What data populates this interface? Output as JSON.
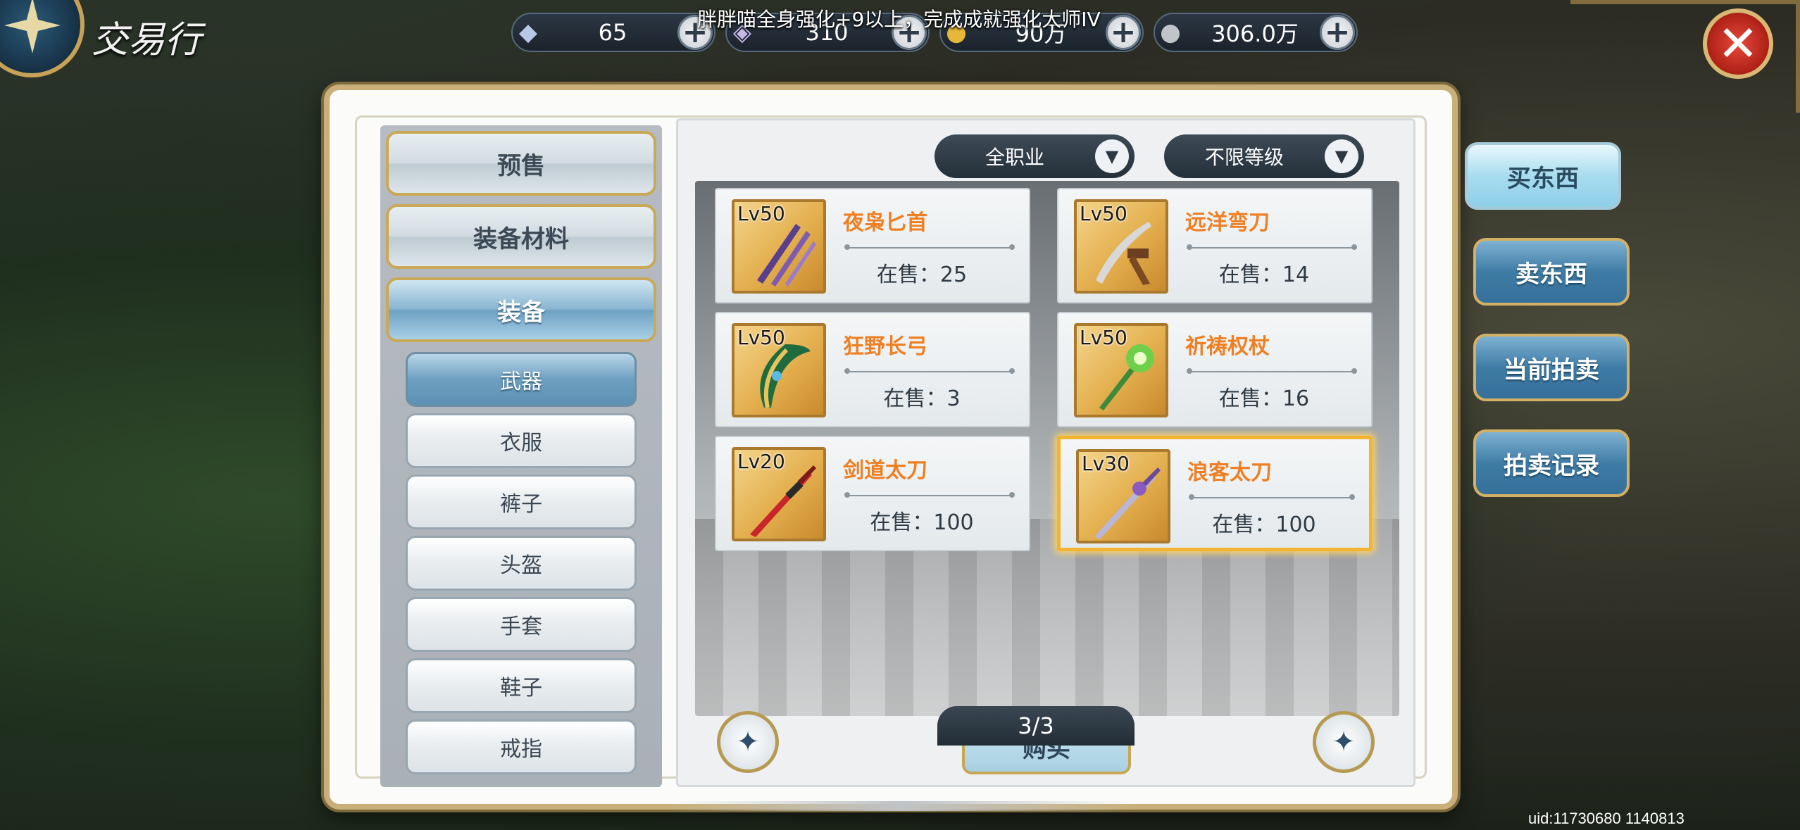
{
  "header": {
    "title": "交易行",
    "notice": "胖胖喵全身强化+9以上，完成成就强化大师IV",
    "currencies": [
      {
        "icon": "crystal-icon",
        "value": "65"
      },
      {
        "icon": "locked-crystal-icon",
        "value": "310"
      },
      {
        "icon": "gold-coin-icon",
        "value": "90万"
      },
      {
        "icon": "silver-coin-icon",
        "value": "306.0万"
      }
    ],
    "close_label": "✕"
  },
  "categories": [
    {
      "label": "预售",
      "active": false
    },
    {
      "label": "装备材料",
      "active": false
    },
    {
      "label": "装备",
      "active": true
    }
  ],
  "subcategories": [
    {
      "label": "武器",
      "active": true
    },
    {
      "label": "衣服",
      "active": false
    },
    {
      "label": "裤子",
      "active": false
    },
    {
      "label": "头盔",
      "active": false
    },
    {
      "label": "手套",
      "active": false
    },
    {
      "label": "鞋子",
      "active": false
    },
    {
      "label": "戒指",
      "active": false
    }
  ],
  "filters": {
    "class": "全职业",
    "level": "不限等级"
  },
  "items": [
    {
      "level": "Lv50",
      "name": "夜枭匕首",
      "stock": "在售：25",
      "selected": false
    },
    {
      "level": "Lv50",
      "name": "远洋弯刀",
      "stock": "在售：14",
      "selected": false
    },
    {
      "level": "Lv50",
      "name": "狂野长弓",
      "stock": "在售：3",
      "selected": false
    },
    {
      "level": "Lv50",
      "name": "祈祷权杖",
      "stock": "在售：16",
      "selected": false
    },
    {
      "level": "Lv20",
      "name": "剑道太刀",
      "stock": "在售：100",
      "selected": false
    },
    {
      "level": "Lv30",
      "name": "浪客太刀",
      "stock": "在售：100",
      "selected": true
    }
  ],
  "pager": "3/3",
  "buy_label": "购买",
  "side_tabs": [
    {
      "label": "买东西",
      "active": true
    },
    {
      "label": "卖东西",
      "active": false
    },
    {
      "label": "当前拍卖",
      "active": false
    },
    {
      "label": "拍卖记录",
      "active": false
    }
  ],
  "uid": "uid:11730680 1140813",
  "colors": {
    "item_name": "#ee7f22",
    "selected_border": "#f3b531",
    "gold_trim": "#c9a957"
  }
}
